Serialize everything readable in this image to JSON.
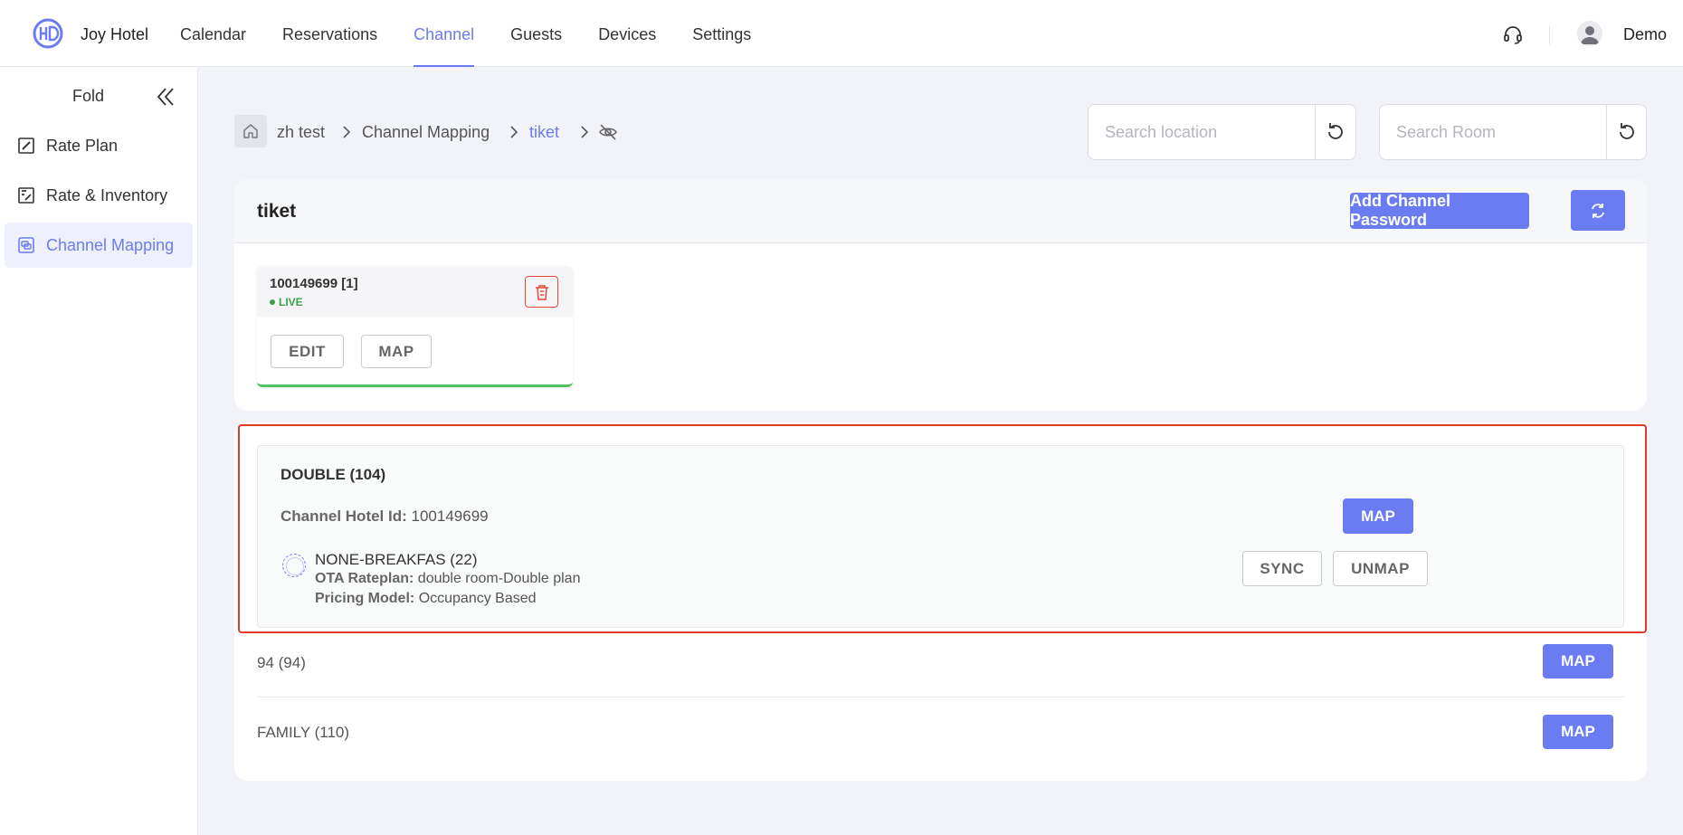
{
  "header": {
    "brand": "Joy Hotel",
    "nav": [
      {
        "label": "Calendar",
        "active": false
      },
      {
        "label": "Reservations",
        "active": false
      },
      {
        "label": "Channel",
        "active": true
      },
      {
        "label": "Guests",
        "active": false
      },
      {
        "label": "Devices",
        "active": false
      },
      {
        "label": "Settings",
        "active": false
      }
    ],
    "user": "Demo",
    "accent_color": "#6b7cf2"
  },
  "sidebar": {
    "fold_label": "Fold",
    "items": [
      {
        "label": "Rate Plan",
        "icon": "rate-plan-icon",
        "active": false
      },
      {
        "label": "Rate & Inventory",
        "icon": "rate-inventory-icon",
        "active": false
      },
      {
        "label": "Channel Mapping",
        "icon": "channel-mapping-icon",
        "active": true
      }
    ]
  },
  "breadcrumb": {
    "items": [
      "zh test",
      "Channel Mapping",
      "tiket"
    ]
  },
  "search": {
    "location_placeholder": "Search location",
    "room_placeholder": "Search Room"
  },
  "channel": {
    "title": "tiket",
    "add_password_label": "Add Channel Password",
    "property": {
      "id_label": "100149699 [1]",
      "status": "LIVE",
      "edit_label": "EDIT",
      "map_label": "MAP"
    }
  },
  "rooms": {
    "expanded": {
      "title": "DOUBLE (104)",
      "hotel_id_key": "Channel Hotel Id:",
      "hotel_id_value": "100149699",
      "map_label": "MAP",
      "rate": {
        "name": "NONE-BREAKFAS (22)",
        "ota_key": "OTA Rateplan:",
        "ota_value": "double room-Double plan",
        "pricing_key": "Pricing Model:",
        "pricing_value": "Occupancy Based",
        "sync_label": "SYNC",
        "unmap_label": "UNMAP"
      }
    },
    "list": [
      {
        "label": "94 (94)",
        "map_label": "MAP"
      },
      {
        "label": "FAMILY (110)",
        "map_label": "MAP"
      }
    ]
  }
}
